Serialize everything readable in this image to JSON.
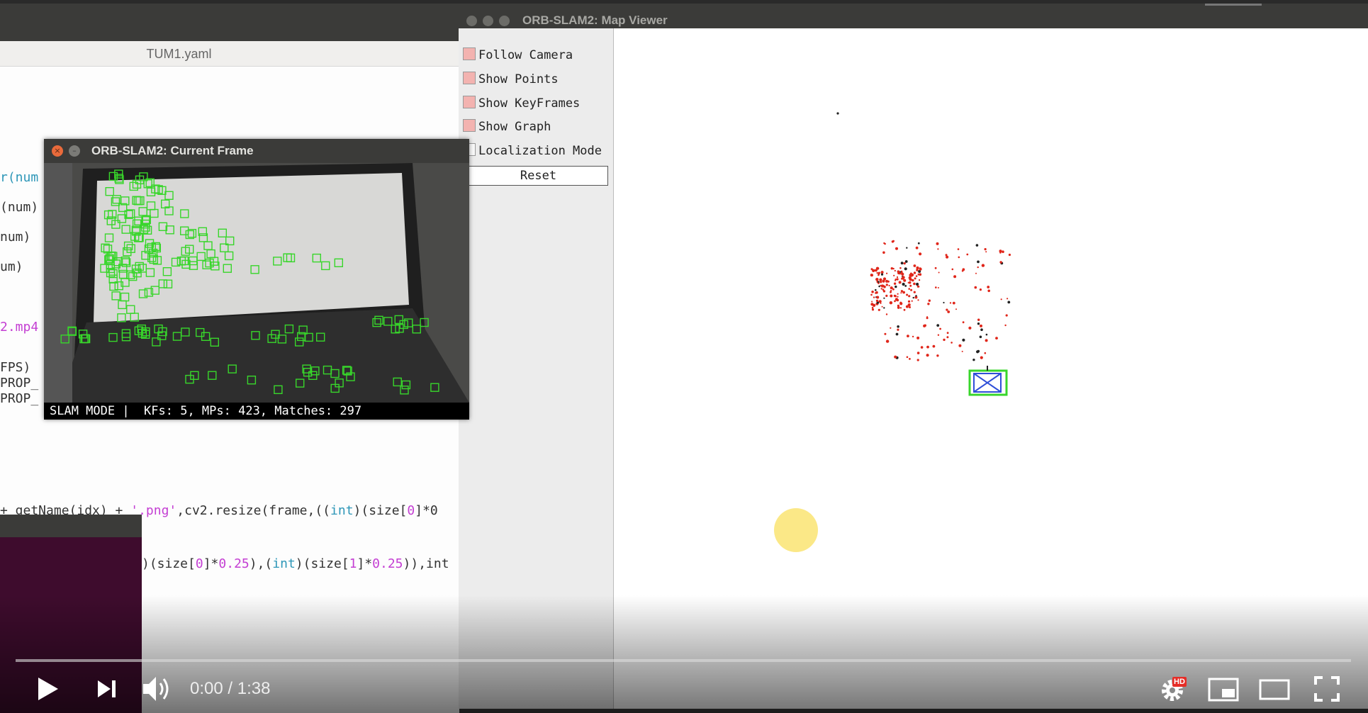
{
  "editor": {
    "tab_title": "TUM1.yaml",
    "lines": {
      "l1": "r(num",
      "l2": "(num)",
      "l3": "num)",
      "l4": "um)",
      "l5": "2.mp4",
      "l6": "FPS)",
      "l7": "PROP_",
      "l8": "PROP_",
      "l9a": "+ getName(idx) + ",
      "l9b": "'.png'",
      "l9c": ",cv2.resize(frame,((",
      "l9d": "int",
      "l9e": ")(size[",
      "l9f": "0",
      "l9g": "]*0",
      "l10a": ")(size[",
      "l10b": "0",
      "l10c": "]*",
      "l10d": "0.25",
      "l10e": "),(",
      "l10f": "int",
      "l10g": ")(size[",
      "l10h": "1",
      "l10i": "]*",
      "l10j": "0.25",
      "l10k": ")),int"
    }
  },
  "current_frame": {
    "title": "ORB-SLAM2: Current Frame",
    "status": "SLAM MODE |  KFs: 5, MPs: 423, Matches: 297"
  },
  "map_viewer": {
    "title": "ORB-SLAM2: Map Viewer",
    "options": [
      {
        "label": "Follow Camera",
        "checked": true
      },
      {
        "label": "Show Points",
        "checked": true
      },
      {
        "label": "Show KeyFrames",
        "checked": true
      },
      {
        "label": "Show Graph",
        "checked": true
      },
      {
        "label": "Localization Mode",
        "checked": false
      }
    ],
    "reset_label": "Reset"
  },
  "video": {
    "current_time": "0:00",
    "separator": " / ",
    "duration": "1:38",
    "hd_badge": "HD",
    "progress": 0
  },
  "colors": {
    "feature_green": "#38d62b",
    "map_point_red": "#e0261a",
    "keyframe_blue": "#2f4fd8",
    "checkbox_on": "#f3b3b0"
  }
}
